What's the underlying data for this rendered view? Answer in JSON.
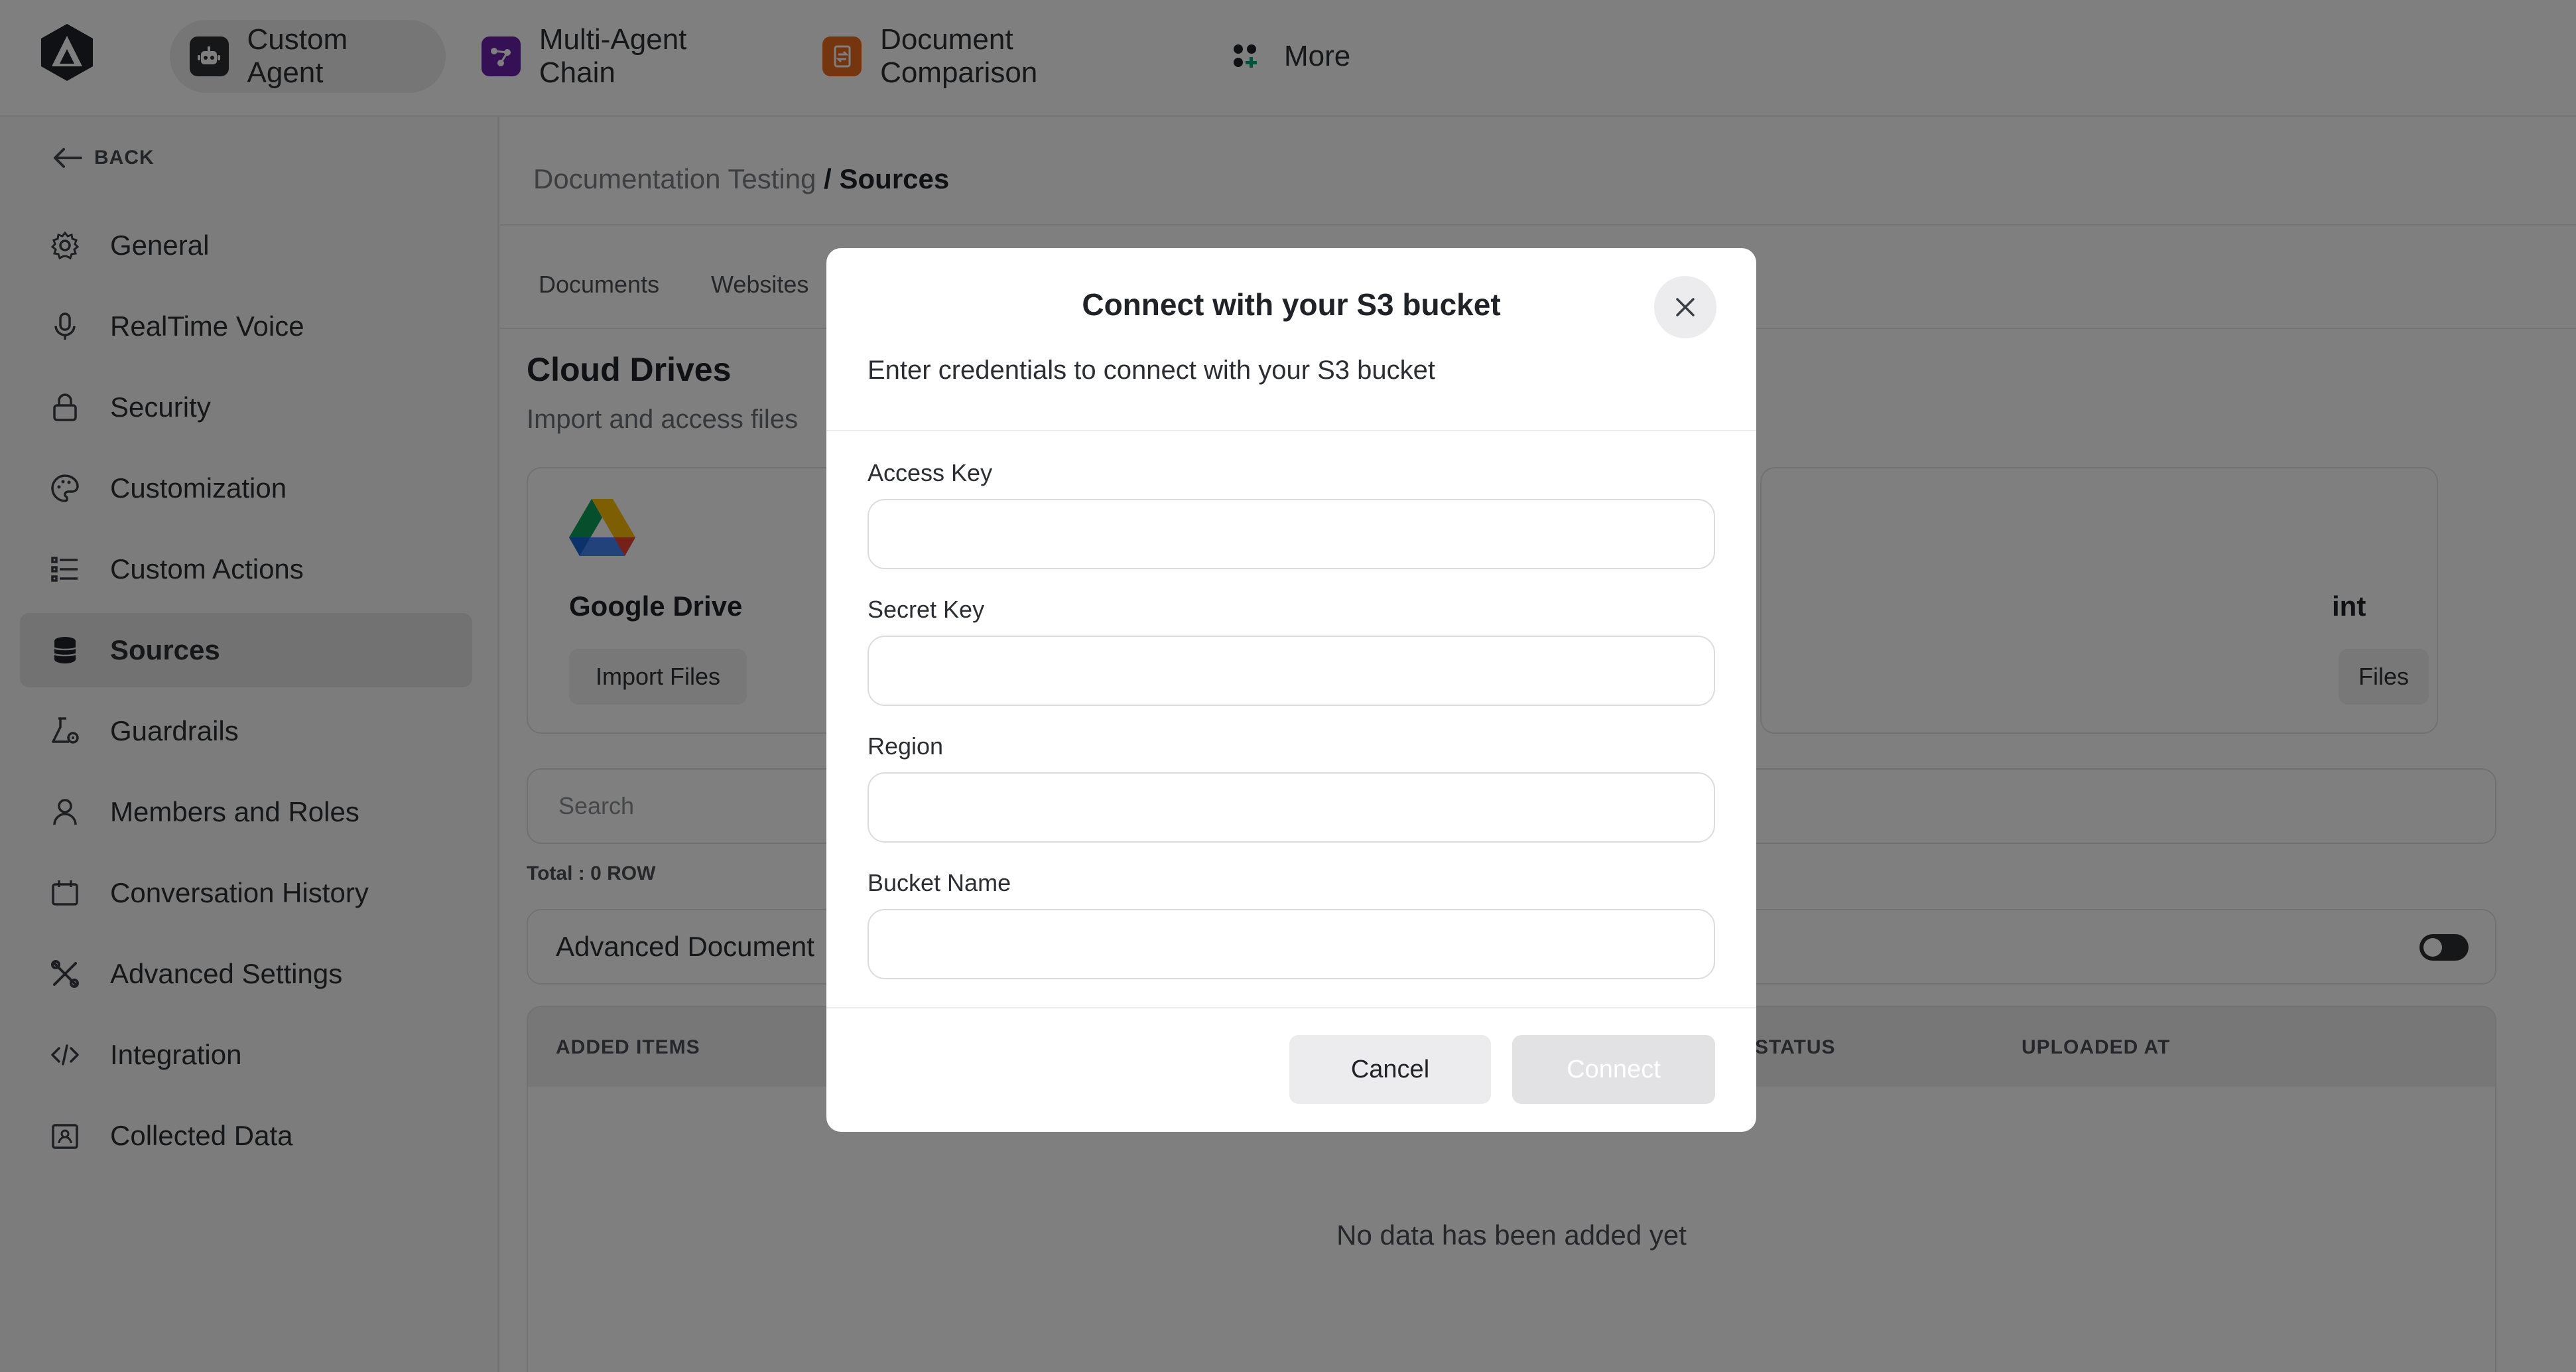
{
  "topbar": {
    "logo_icon": "triangle-logo-icon",
    "tabs": [
      {
        "label": "Custom Agent",
        "icon": "robot-icon",
        "active": true,
        "color": "#2b2f33"
      },
      {
        "label": "Multi-Agent Chain",
        "icon": "chain-icon",
        "active": false,
        "color": "#6b21a8"
      },
      {
        "label": "Document Comparison",
        "icon": "document-compare-icon",
        "active": false,
        "color": "#ea6a1d"
      },
      {
        "label": "More",
        "icon": "apps-plus-icon",
        "active": false,
        "color": "#1f2328"
      }
    ]
  },
  "sidebar": {
    "back_label": "BACK",
    "items": [
      {
        "label": "General",
        "icon": "gear-icon"
      },
      {
        "label": "RealTime Voice",
        "icon": "microphone-icon"
      },
      {
        "label": "Security",
        "icon": "lock-icon"
      },
      {
        "label": "Customization",
        "icon": "palette-icon"
      },
      {
        "label": "Custom Actions",
        "icon": "list-icon"
      },
      {
        "label": "Sources",
        "icon": "database-icon",
        "active": true
      },
      {
        "label": "Guardrails",
        "icon": "flask-gear-icon"
      },
      {
        "label": "Members and Roles",
        "icon": "user-icon"
      },
      {
        "label": "Conversation History",
        "icon": "calendar-icon"
      },
      {
        "label": "Advanced Settings",
        "icon": "tools-icon"
      },
      {
        "label": "Integration",
        "icon": "code-icon"
      },
      {
        "label": "Collected Data",
        "icon": "contact-icon"
      }
    ]
  },
  "main": {
    "breadcrumb": {
      "parent": "Documentation Testing",
      "separator": " / ",
      "current": "Sources"
    },
    "sub_tabs": [
      "Documents",
      "Websites"
    ],
    "cloud": {
      "title": "Cloud Drives",
      "subtitle": "Import and access files"
    },
    "cards": [
      {
        "name": "Google Drive",
        "button": "Import Files",
        "icon": "google-drive-icon"
      },
      {
        "name": "int",
        "button": "Files"
      }
    ],
    "search_placeholder": "Search",
    "total": "Total : 0 ROW",
    "advanced_label": "Advanced Document",
    "advanced_toggle_on": false,
    "table": {
      "headers": [
        "ADDED ITEMS",
        "STATUS",
        "UPLOADED AT"
      ],
      "empty_message": "No data has been added yet"
    }
  },
  "modal": {
    "title": "Connect with your S3 bucket",
    "description": "Enter credentials to connect with your S3 bucket",
    "fields": [
      {
        "label": "Access Key",
        "value": "",
        "placeholder": ""
      },
      {
        "label": "Secret Key",
        "value": "",
        "placeholder": ""
      },
      {
        "label": "Region",
        "value": "",
        "placeholder": ""
      },
      {
        "label": "Bucket Name",
        "value": "",
        "placeholder": ""
      }
    ],
    "cancel_label": "Cancel",
    "connect_label": "Connect"
  },
  "colors": {
    "overlay": "#000000",
    "active_tab_bg": "#ececee",
    "connect_disabled": "#e2e2e4"
  }
}
